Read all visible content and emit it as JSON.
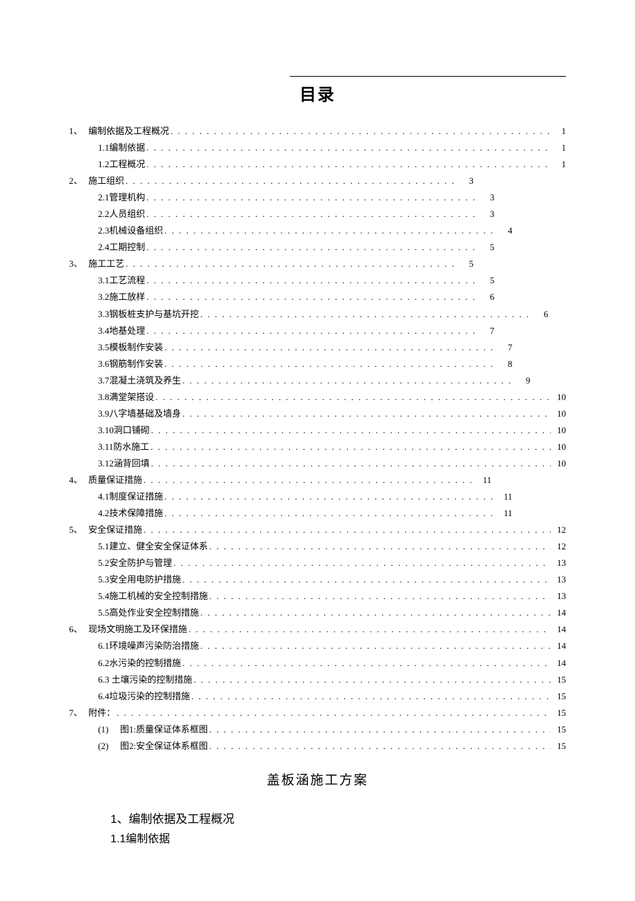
{
  "doc_title": "目录",
  "subtitle": "盖板涵施工方案",
  "section_heading_1": "1、编制依据及工程概况",
  "section_heading_2": "1.1编制依据",
  "toc": {
    "s1": {
      "marker": "1、",
      "label": "编制依据及工程概况",
      "page": "1"
    },
    "s1_1": {
      "label": "1.1编制依据",
      "page": "1"
    },
    "s1_2": {
      "label": "1.2工程概况",
      "page": "1"
    },
    "s2": {
      "marker": "2、",
      "label": "施工组织",
      "page": "3"
    },
    "s2_1": {
      "label": "2.1管理机构",
      "page": "3"
    },
    "s2_2": {
      "label": "2.2人员组织",
      "page": "3"
    },
    "s2_3": {
      "label": "2.3机械设备组织",
      "page": "4"
    },
    "s2_4": {
      "label": "2.4工期控制",
      "page": "5"
    },
    "s3": {
      "marker": "3、",
      "label": "施工工艺",
      "page": "5"
    },
    "s3_1": {
      "label": "3.1工艺流程",
      "page": "5"
    },
    "s3_2": {
      "label": "3.2施工放样",
      "page": "6"
    },
    "s3_3": {
      "label": "3.3钢板桩支护与基坑开挖",
      "page": "6"
    },
    "s3_4": {
      "label": "3.4地基处理",
      "page": "7"
    },
    "s3_5": {
      "label": "3.5模板制作安装",
      "page": "7"
    },
    "s3_6": {
      "label": "3.6钢筋制作安装",
      "page": "8"
    },
    "s3_7": {
      "label": "3.7混凝土浇筑及养生",
      "page": "9"
    },
    "s3_8": {
      "label": "3.8满堂架搭设",
      "page": "10"
    },
    "s3_9": {
      "label": "3.9八字墙基础及墙身",
      "page": "10"
    },
    "s3_10": {
      "label": "3.10洞口铺砌",
      "page": "10"
    },
    "s3_11": {
      "label": "3.11防水施工",
      "page": "10"
    },
    "s3_12": {
      "label": "3.12涵背回填",
      "page": "10"
    },
    "s4": {
      "marker": "4、",
      "label": "质量保证措施",
      "page": "11"
    },
    "s4_1": {
      "label": "4.1制度保证措施",
      "page": "11"
    },
    "s4_2": {
      "label": "4.2技术保障措施",
      "page": "11"
    },
    "s5": {
      "marker": "5、",
      "label": "安全保证措施",
      "page": "12"
    },
    "s5_1": {
      "label": "5.1建立、健全安全保证体系",
      "page": "12"
    },
    "s5_2": {
      "label": "5.2安全防护与管理",
      "page": "13"
    },
    "s5_3": {
      "label": "5.3安全用电防护措施",
      "page": "13"
    },
    "s5_4": {
      "label": "5.4施工机械的安全控制措施",
      "page": "13"
    },
    "s5_5": {
      "label": "5.5高处作业安全控制措施",
      "page": "14"
    },
    "s6": {
      "marker": "6、",
      "label": "现场文明施工及环保措施",
      "page": "14"
    },
    "s6_1": {
      "label": "6.1环境噪声污染防治措施",
      "page": "14"
    },
    "s6_2": {
      "label": "6.2水污染的控制措施",
      "page": "14"
    },
    "s6_3": {
      "label": "6.3 土壤污染的控制措施",
      "page": "15"
    },
    "s6_4": {
      "label": "6.4垃圾污染的控制措施",
      "page": "15"
    },
    "s7": {
      "marker": "7、",
      "label": "附件：",
      "page": "15"
    },
    "s7_1": {
      "marker": "(1)",
      "label": "图1:质量保证体系框图",
      "page": "15"
    },
    "s7_2": {
      "marker": "(2)",
      "label": "图2:安全保证体系框图",
      "page": "15"
    }
  }
}
